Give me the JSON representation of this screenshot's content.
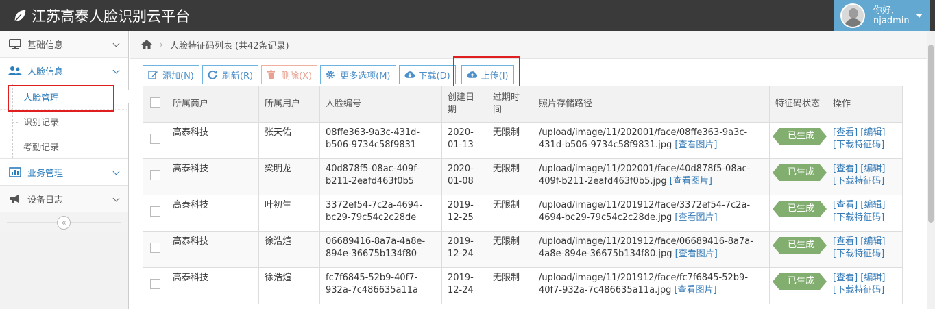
{
  "header": {
    "title": "江苏高泰人脸识别云平台",
    "greeting": "你好,",
    "username": "njadmin"
  },
  "sidebar": {
    "items": [
      {
        "label": "基础信息"
      },
      {
        "label": "人脸信息"
      },
      {
        "label": "业务管理"
      },
      {
        "label": "设备日志"
      }
    ],
    "sub_items": [
      {
        "label": "人脸管理"
      },
      {
        "label": "识别记录"
      },
      {
        "label": "考勤记录"
      }
    ],
    "collapse_glyph": "«"
  },
  "breadcrumb": {
    "sep": "›",
    "current": "人脸特征码列表 (共42条记录)"
  },
  "toolbar": {
    "add": "添加(N)",
    "refresh": "刷新(R)",
    "delete": "删除(X)",
    "more": "更多选项(M)",
    "download": "下载(D)",
    "upload": "上传(I)"
  },
  "table": {
    "headers": [
      "所属商户",
      "所属用户",
      "人脸编号",
      "创建日期",
      "过期时间",
      "照片存储路径",
      "特征码状态",
      "操作"
    ],
    "rows": [
      {
        "merchant": "高泰科技",
        "user": "张天佑",
        "face_id": "08ffe363-9a3c-431d-b506-9734c58f9831",
        "date": "2020-01-13",
        "expire": "无限制",
        "path": "/upload/image/11/202001/face/08ffe363-9a3c-431d-b506-9734c58f9831.jpg",
        "view_img": "[查看图片]",
        "status": "已生成",
        "op_view": "[查看]",
        "op_edit": "[编辑]",
        "op_download": "[下载特征码]"
      },
      {
        "merchant": "高泰科技",
        "user": "梁明龙",
        "face_id": "40d878f5-08ac-409f-b211-2eafd463f0b5",
        "date": "2020-01-08",
        "expire": "无限制",
        "path": "/upload/image/11/202001/face/40d878f5-08ac-409f-b211-2eafd463f0b5.jpg",
        "view_img": "[查看图片]",
        "status": "已生成",
        "op_view": "[查看]",
        "op_edit": "[编辑]",
        "op_download": "[下载特征码]"
      },
      {
        "merchant": "高泰科技",
        "user": "叶初生",
        "face_id": "3372ef54-7c2a-4694-bc29-79c54c2c28de",
        "date": "2019-12-25",
        "expire": "无限制",
        "path": "/upload/image/11/201912/face/3372ef54-7c2a-4694-bc29-79c54c2c28de.jpg",
        "view_img": "[查看图片]",
        "status": "已生成",
        "op_view": "[查看]",
        "op_edit": "[编辑]",
        "op_download": "[下载特征码]"
      },
      {
        "merchant": "高泰科技",
        "user": "徐浩煊",
        "face_id": "06689416-8a7a-4a8e-894e-36675b134f80",
        "date": "2019-12-24",
        "expire": "无限制",
        "path": "/upload/image/11/201912/face/06689416-8a7a-4a8e-894e-36675b134f80.jpg",
        "view_img": "[查看图片]",
        "status": "已生成",
        "op_view": "[查看]",
        "op_edit": "[编辑]",
        "op_download": "[下载特征码]"
      },
      {
        "merchant": "高泰科技",
        "user": "徐浩煊",
        "face_id": "fc7f6845-52b9-40f7-932a-7c486635a11a",
        "date": "2019-12-24",
        "expire": "无限制",
        "path": "/upload/image/11/201912/face/fc7f6845-52b9-40f7-932a-7c486635a11a.jpg",
        "view_img": "[查看图片]",
        "status": "已生成",
        "op_view": "[查看]",
        "op_edit": "[编辑]",
        "op_download": "[下载特征码]"
      }
    ]
  },
  "colors": {
    "header_bg": "#3a3a3a",
    "user_box": "#62a8d1",
    "accent": "#2b7dbc",
    "status_tag": "#82af6f",
    "highlight": "#e02020"
  }
}
